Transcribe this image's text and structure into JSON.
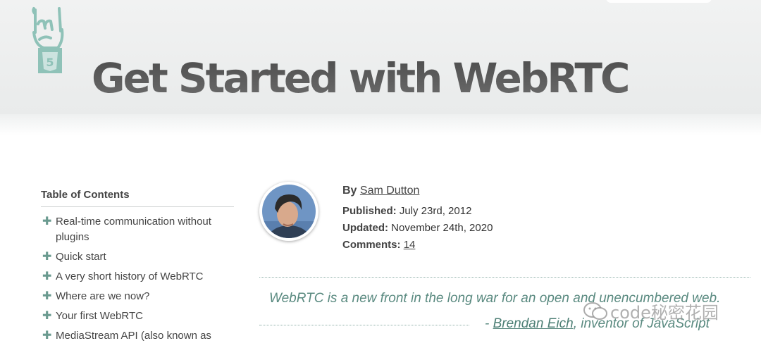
{
  "header": {
    "title": "Get Started with WebRTC",
    "logo_icon": "html5-horns-hand-icon"
  },
  "toc": {
    "heading": "Table of Contents",
    "items": [
      "Real-time communication without plugins",
      "Quick start",
      "A very short history of WebRTC",
      "Where are we now?",
      "Your first WebRTC",
      "MediaStream API (also known as"
    ]
  },
  "author": {
    "by_label": "By",
    "name": "Sam Dutton",
    "published_label": "Published:",
    "published_date": "July 23rd, 2012",
    "updated_label": "Updated:",
    "updated_date": "November 24th, 2020",
    "comments_label": "Comments:",
    "comments_count": "14"
  },
  "quote": {
    "text": "WebRTC is a new front in the long war for an open and unencumbered web.",
    "dash": "- ",
    "author": "Brendan Eich",
    "author_suffix": ", inventor of JavaScript"
  },
  "watermark": {
    "text": "code秘密花园",
    "icon": "wechat-icon"
  },
  "colors": {
    "accent": "#6a9a8f",
    "quote": "#5a8a80",
    "title": "#555555"
  }
}
